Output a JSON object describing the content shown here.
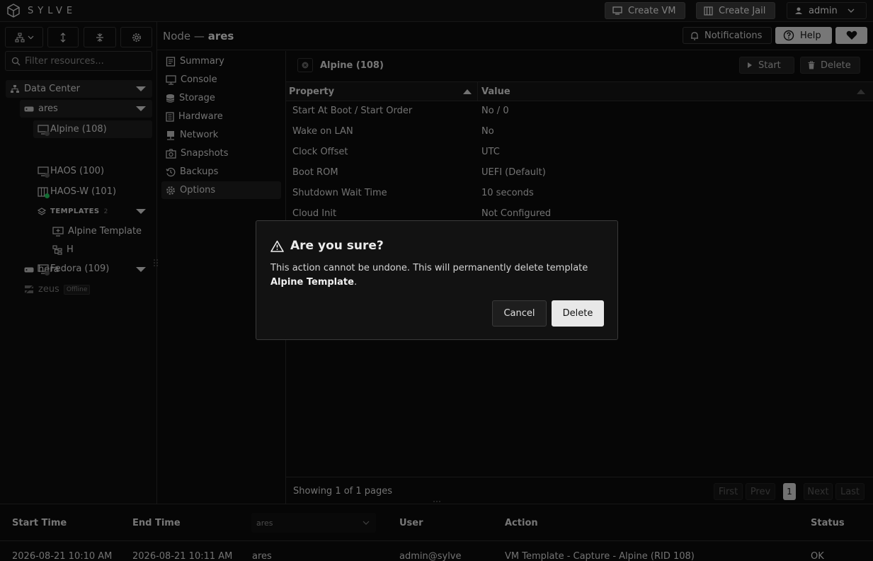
{
  "app": {
    "brand": "SYLVE"
  },
  "topbar": {
    "create_vm": "Create VM",
    "create_jail": "Create Jail",
    "user": "admin"
  },
  "sidebar": {
    "filter_placeholder": "Filter resources...",
    "datacenter": "Data Center",
    "nodes": [
      {
        "label": "ares"
      },
      {
        "label": "hera"
      },
      {
        "label": "zeus",
        "badge": "Offline"
      }
    ],
    "vms": {
      "alpine": "Alpine (108)",
      "haos": "HAOS (100)",
      "haosw": "HAOS-W (101)",
      "fedora": "Fedora (109)"
    },
    "templates": {
      "label": "TEMPLATES",
      "count": "2",
      "items": [
        "Alpine Template",
        "H"
      ]
    }
  },
  "header": {
    "prefix": "Node —",
    "node": "ares",
    "notifications": "Notifications",
    "help": "Help"
  },
  "vm_nav": {
    "items": [
      "Summary",
      "Console",
      "Storage",
      "Hardware",
      "Network",
      "Snapshots",
      "Backups",
      "Options"
    ],
    "active": "Options"
  },
  "content": {
    "vm_name": "Alpine (108)",
    "start": "Start",
    "delete": "Delete",
    "columns": [
      "Property",
      "Value"
    ],
    "rows": [
      {
        "property": "Start At Boot / Start Order",
        "value": "No / 0"
      },
      {
        "property": "Wake on LAN",
        "value": "No"
      },
      {
        "property": "Clock Offset",
        "value": "UTC"
      },
      {
        "property": "Boot ROM",
        "value": "UEFI (Default)"
      },
      {
        "property": "Shutdown Wait Time",
        "value": "10 seconds"
      },
      {
        "property": "Cloud Init",
        "value": "Not Configured"
      }
    ],
    "footer": "Showing 1 of 1 pages",
    "pager": {
      "first": "First",
      "prev": "Prev",
      "page": "1",
      "next": "Next",
      "last": "Last"
    }
  },
  "task_log": {
    "columns": [
      "Start Time",
      "End Time",
      "User",
      "Action",
      "Status"
    ],
    "node_filter": "ares",
    "rows": [
      {
        "start": "2026-08-21 10:10 AM",
        "end": "2026-08-21 10:11 AM",
        "node": "ares",
        "user": "admin@sylve",
        "action": "VM Template - Capture - Alpine (RID 108)",
        "status": "OK"
      }
    ]
  },
  "dialog": {
    "title": "Are you sure?",
    "message_prefix": "This action cannot be undone. This will permanently delete template",
    "target": "Alpine Template",
    "cancel": "Cancel",
    "confirm": "Delete"
  },
  "colors": {
    "online": "#22c55e",
    "offline": "#555555",
    "accent": "#e8e8e8"
  }
}
